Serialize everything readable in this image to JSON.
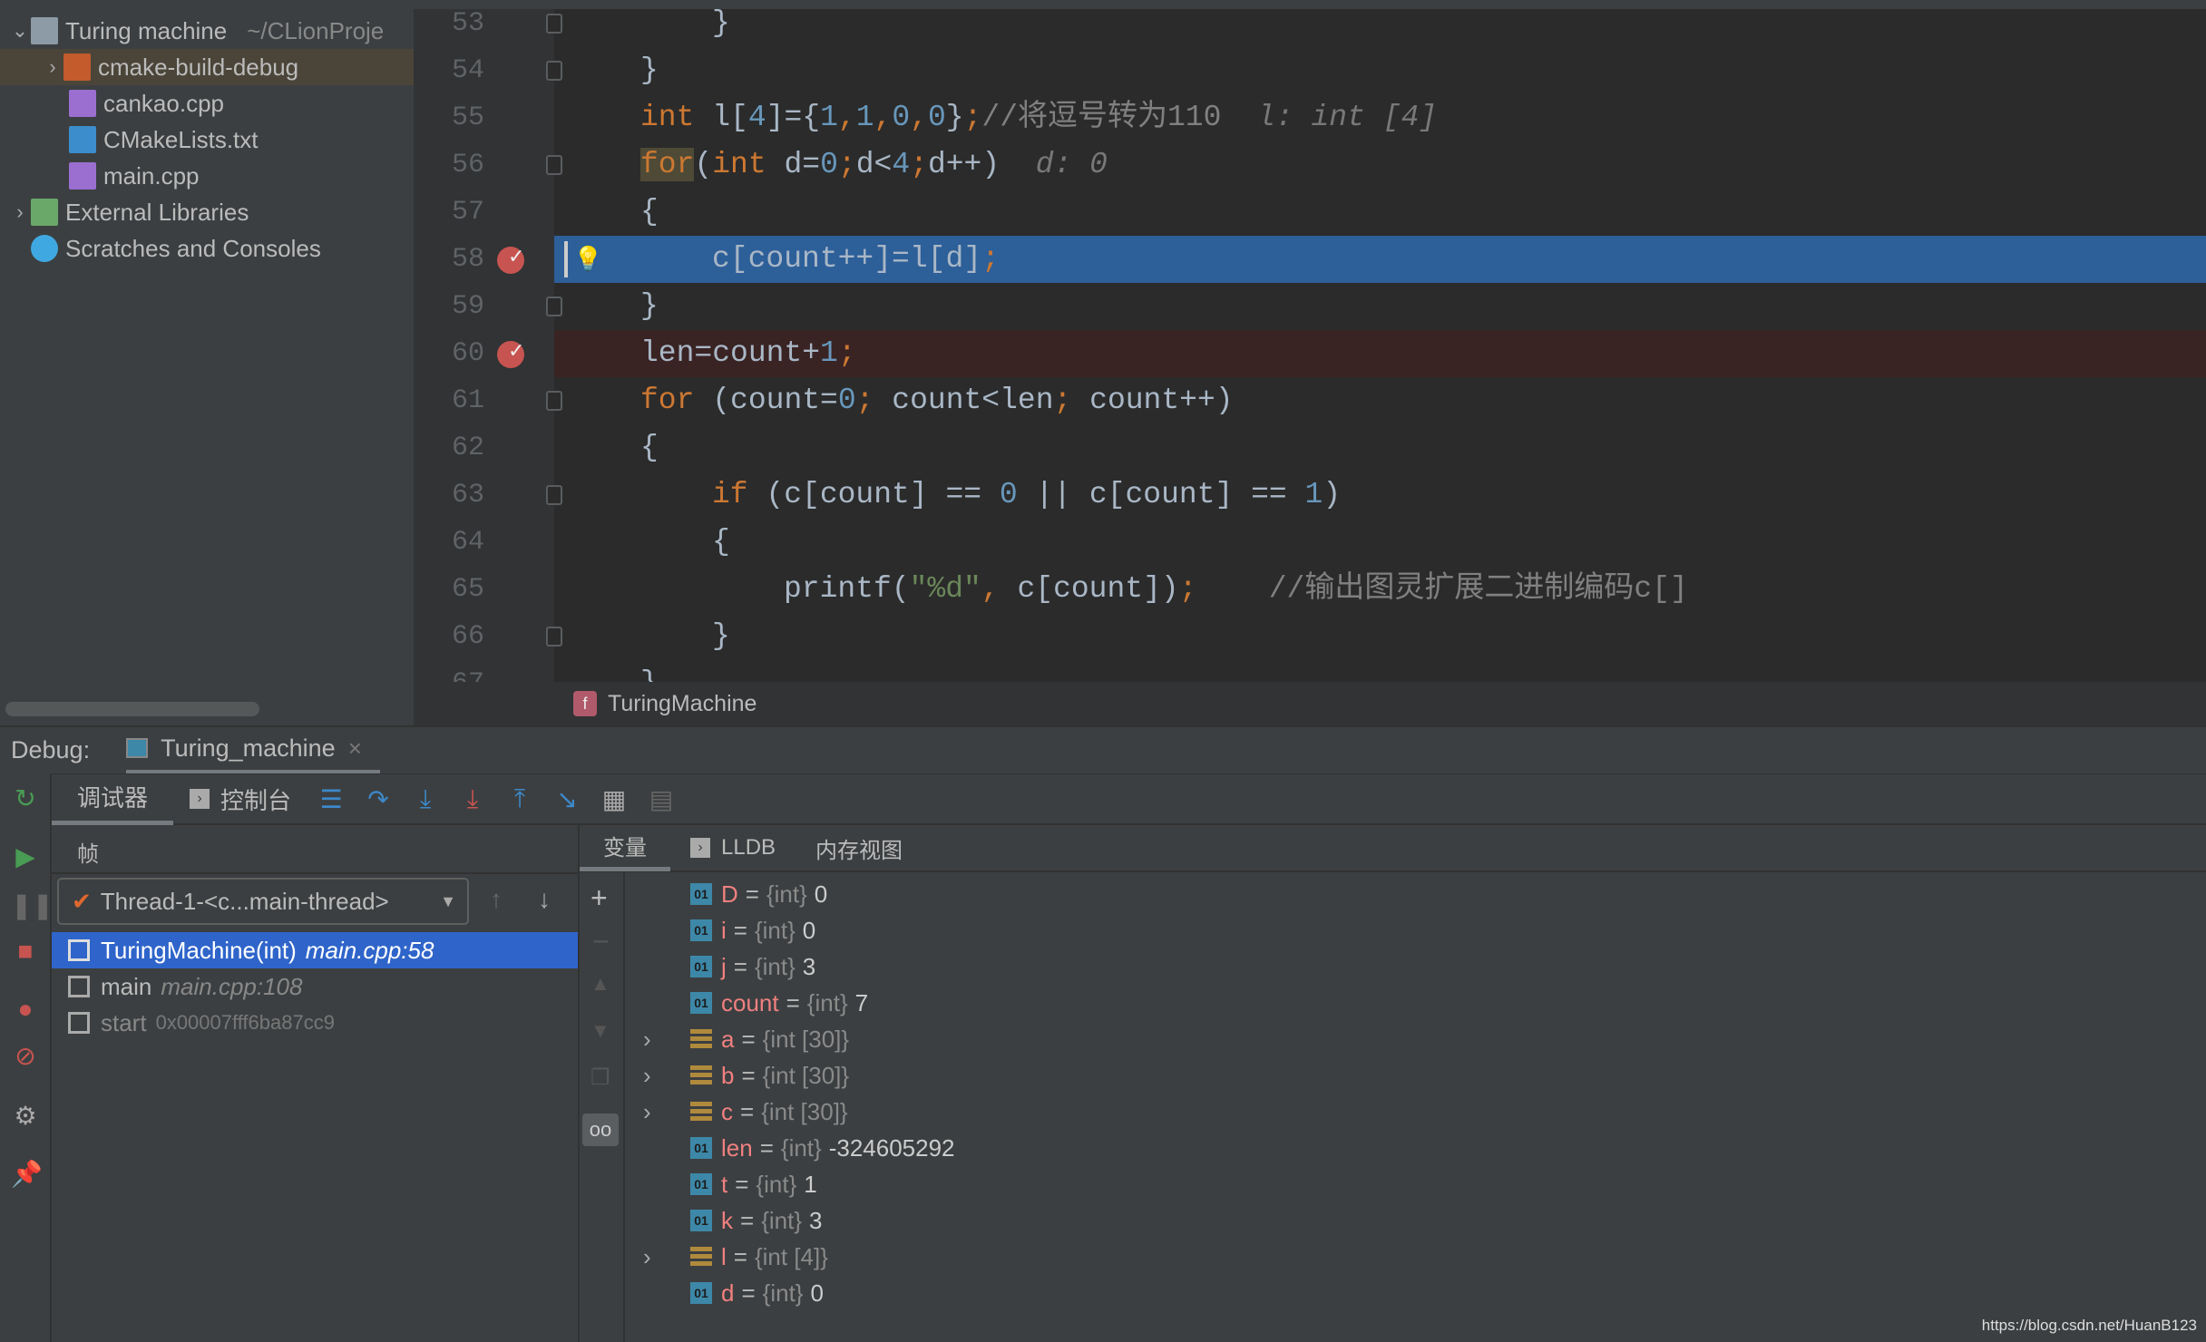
{
  "project": {
    "items": [
      {
        "label": "Turing machine",
        "path": "~/CLionProje",
        "chevron": "open",
        "icon": "folder-icon"
      },
      {
        "label": "cmake-build-debug",
        "chevron": "closed",
        "icon": "orange-folder-icon"
      },
      {
        "label": "cankao.cpp",
        "icon": "cpp-file-icon"
      },
      {
        "label": "CMakeLists.txt",
        "icon": "cmake-icon"
      },
      {
        "label": "main.cpp",
        "icon": "cpp-file-icon"
      },
      {
        "label": "External Libraries",
        "chevron": "closed",
        "icon": "libraries-icon"
      },
      {
        "label": "Scratches and Consoles",
        "icon": "scratches-icon"
      }
    ]
  },
  "editor": {
    "colors": {
      "keyword": "#cc7832",
      "number": "#6897bb",
      "string": "#6a8759",
      "comment": "#808080",
      "text": "#a9b7c6",
      "hint": "#787878"
    },
    "lines": [
      {
        "n": "53",
        "indent": 1,
        "fold": true,
        "tokens": [
          [
            "}",
            "text"
          ]
        ]
      },
      {
        "n": "54",
        "indent": 0,
        "fold": true,
        "tokens": [
          [
            "}",
            "text"
          ]
        ]
      },
      {
        "n": "55",
        "indent": 0,
        "tokens": [
          [
            "int",
            "keyword"
          ],
          [
            " l[",
            "text"
          ],
          [
            "4",
            "number"
          ],
          [
            "]={",
            "text"
          ],
          [
            "1",
            "number"
          ],
          [
            ",",
            "keyword"
          ],
          [
            "1",
            "number"
          ],
          [
            ",",
            "keyword"
          ],
          [
            "0",
            "number"
          ],
          [
            ",",
            "keyword"
          ],
          [
            "0",
            "number"
          ],
          [
            "}",
            "text"
          ],
          [
            ";",
            "keyword"
          ],
          [
            "//将逗号转为110",
            "comment"
          ],
          [
            "  l: int [4]",
            "hint"
          ]
        ]
      },
      {
        "n": "56",
        "indent": 0,
        "fold": true,
        "tokens": [
          [
            "for",
            "keyword"
          ],
          [
            "(",
            "text"
          ],
          [
            "int",
            "keyword"
          ],
          [
            " d=",
            "text"
          ],
          [
            "0",
            "number"
          ],
          [
            ";",
            "keyword"
          ],
          [
            "d<",
            "text"
          ],
          [
            "4",
            "number"
          ],
          [
            ";",
            "keyword"
          ],
          [
            "d++)",
            "text"
          ],
          [
            "  d: 0",
            "hint"
          ]
        ]
      },
      {
        "n": "57",
        "indent": 0,
        "tokens": [
          [
            "{",
            "text"
          ]
        ]
      },
      {
        "n": "58",
        "indent": 1,
        "state": "current",
        "breakpoint": true,
        "tokens": [
          [
            "c[count++]=l[d]",
            "text"
          ],
          [
            ";",
            "keyword"
          ]
        ]
      },
      {
        "n": "59",
        "indent": 0,
        "fold": true,
        "tokens": [
          [
            "}",
            "text"
          ]
        ]
      },
      {
        "n": "60",
        "indent": 0,
        "state": "breakpoint",
        "breakpoint": true,
        "tokens": [
          [
            "len=count+",
            "text"
          ],
          [
            "1",
            "number"
          ],
          [
            ";",
            "keyword"
          ]
        ]
      },
      {
        "n": "61",
        "indent": 0,
        "fold": true,
        "tokens": [
          [
            "for",
            "keyword"
          ],
          [
            " (count=",
            "text"
          ],
          [
            "0",
            "number"
          ],
          [
            ";",
            "keyword"
          ],
          [
            " count<len",
            "text"
          ],
          [
            ";",
            "keyword"
          ],
          [
            " count++)",
            "text"
          ]
        ]
      },
      {
        "n": "62",
        "indent": 0,
        "tokens": [
          [
            "{",
            "text"
          ]
        ]
      },
      {
        "n": "63",
        "indent": 1,
        "fold": true,
        "tokens": [
          [
            "if",
            "keyword"
          ],
          [
            " (c[count] == ",
            "text"
          ],
          [
            "0",
            "number"
          ],
          [
            " || c[count] == ",
            "text"
          ],
          [
            "1",
            "number"
          ],
          [
            ")",
            "text"
          ]
        ]
      },
      {
        "n": "64",
        "indent": 1,
        "tokens": [
          [
            "{",
            "text"
          ]
        ]
      },
      {
        "n": "65",
        "indent": 2,
        "tokens": [
          [
            "printf(",
            "text"
          ],
          [
            "\"%d\"",
            "string"
          ],
          [
            ",",
            "keyword"
          ],
          [
            " c[count])",
            "text"
          ],
          [
            ";",
            "keyword"
          ],
          [
            "    //输出图灵扩展二进制编码c[]",
            "comment"
          ]
        ]
      },
      {
        "n": "66",
        "indent": 1,
        "fold": true,
        "tokens": [
          [
            "}",
            "text"
          ]
        ]
      },
      {
        "n": "67",
        "indent": 0,
        "tokens": [
          [
            "}",
            "text"
          ]
        ]
      }
    ]
  },
  "breadcrumb": {
    "function": "TuringMachine",
    "icon": "f"
  },
  "debug": {
    "label": "Debug:",
    "session": "Turing_machine",
    "close": "×"
  },
  "toolbar": {
    "debugger_tab": "调试器",
    "console_tab": "控制台"
  },
  "frames": {
    "header": "帧",
    "thread": "Thread-1-<c...main-thread>",
    "items": [
      {
        "name": "TuringMachine(int)",
        "loc": "main.cpp:58",
        "selected": true
      },
      {
        "name": "main",
        "loc": "main.cpp:108"
      },
      {
        "name": "start",
        "loc": "0x00007fff6ba87cc9",
        "dim": true
      }
    ]
  },
  "vars": {
    "tabs": [
      "变量",
      "LLDB",
      "内存视图"
    ],
    "items": [
      {
        "name": "D",
        "type": "{int}",
        "value": "0"
      },
      {
        "name": "i",
        "type": "{int}",
        "value": "0"
      },
      {
        "name": "j",
        "type": "{int}",
        "value": "3"
      },
      {
        "name": "count",
        "type": "{int}",
        "value": "7"
      },
      {
        "name": "a",
        "type": "{int [30]}",
        "value": "",
        "array": true
      },
      {
        "name": "b",
        "type": "{int [30]}",
        "value": "",
        "array": true
      },
      {
        "name": "c",
        "type": "{int [30]}",
        "value": "",
        "array": true
      },
      {
        "name": "len",
        "type": "{int}",
        "value": "-324605292"
      },
      {
        "name": "t",
        "type": "{int}",
        "value": "1"
      },
      {
        "name": "k",
        "type": "{int}",
        "value": "3"
      },
      {
        "name": "l",
        "type": "{int [4]}",
        "value": "",
        "array": true
      },
      {
        "name": "d",
        "type": "{int}",
        "value": "0"
      }
    ]
  },
  "watermark": "https://blog.csdn.net/HuanB123"
}
